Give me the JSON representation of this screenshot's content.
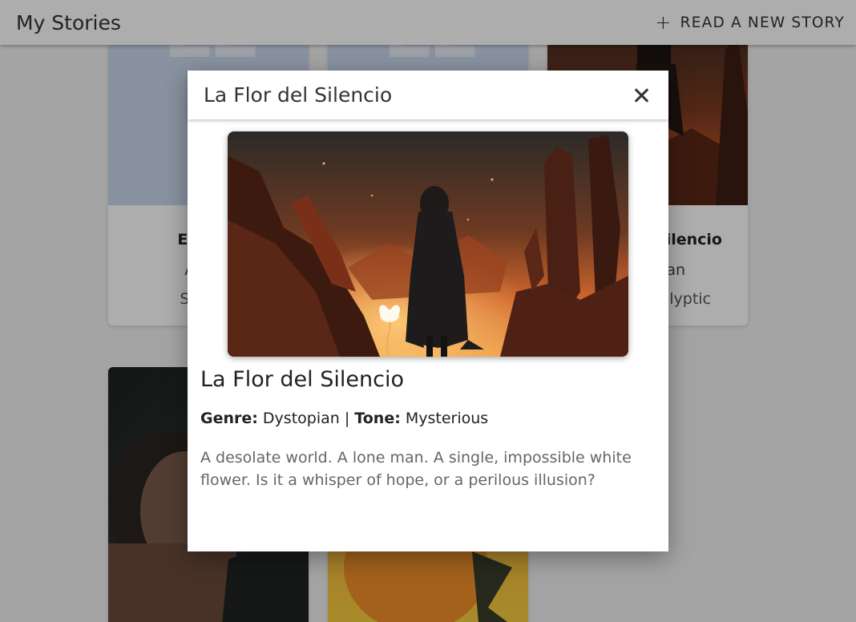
{
  "header": {
    "title": "My Stories",
    "new_story_label": "READ A NEW STORY"
  },
  "cards": [
    {
      "title": "El Llam",
      "meta": "Action",
      "meta2": "Surviva",
      "image": "placeholder"
    },
    {
      "title": "",
      "meta": "",
      "meta2": "",
      "image": "placeholder"
    },
    {
      "title": "ilencio",
      "meta": "an",
      "meta2": "lyptic",
      "image": "desert-wanderer"
    },
    {
      "image": "woman-portrait"
    },
    {
      "image": "yellow-abstract"
    }
  ],
  "modal": {
    "header_title": "La Flor del Silencio",
    "story_title": "La Flor del Silencio",
    "genre_label": "Genre:",
    "genre": "Dystopian",
    "separator": "|",
    "tone_label": "Tone:",
    "tone": "Mysterious",
    "description": "A desolate world. A lone man. A single, impossible white flower. Is it a whisper of hope, or a perilous illusion?",
    "image": "cloaked-figure-with-white-flower-in-desert-canyon"
  },
  "colors": {
    "placeholder_bg": "#c9d8ec",
    "desert_orange": "#d9662e"
  }
}
